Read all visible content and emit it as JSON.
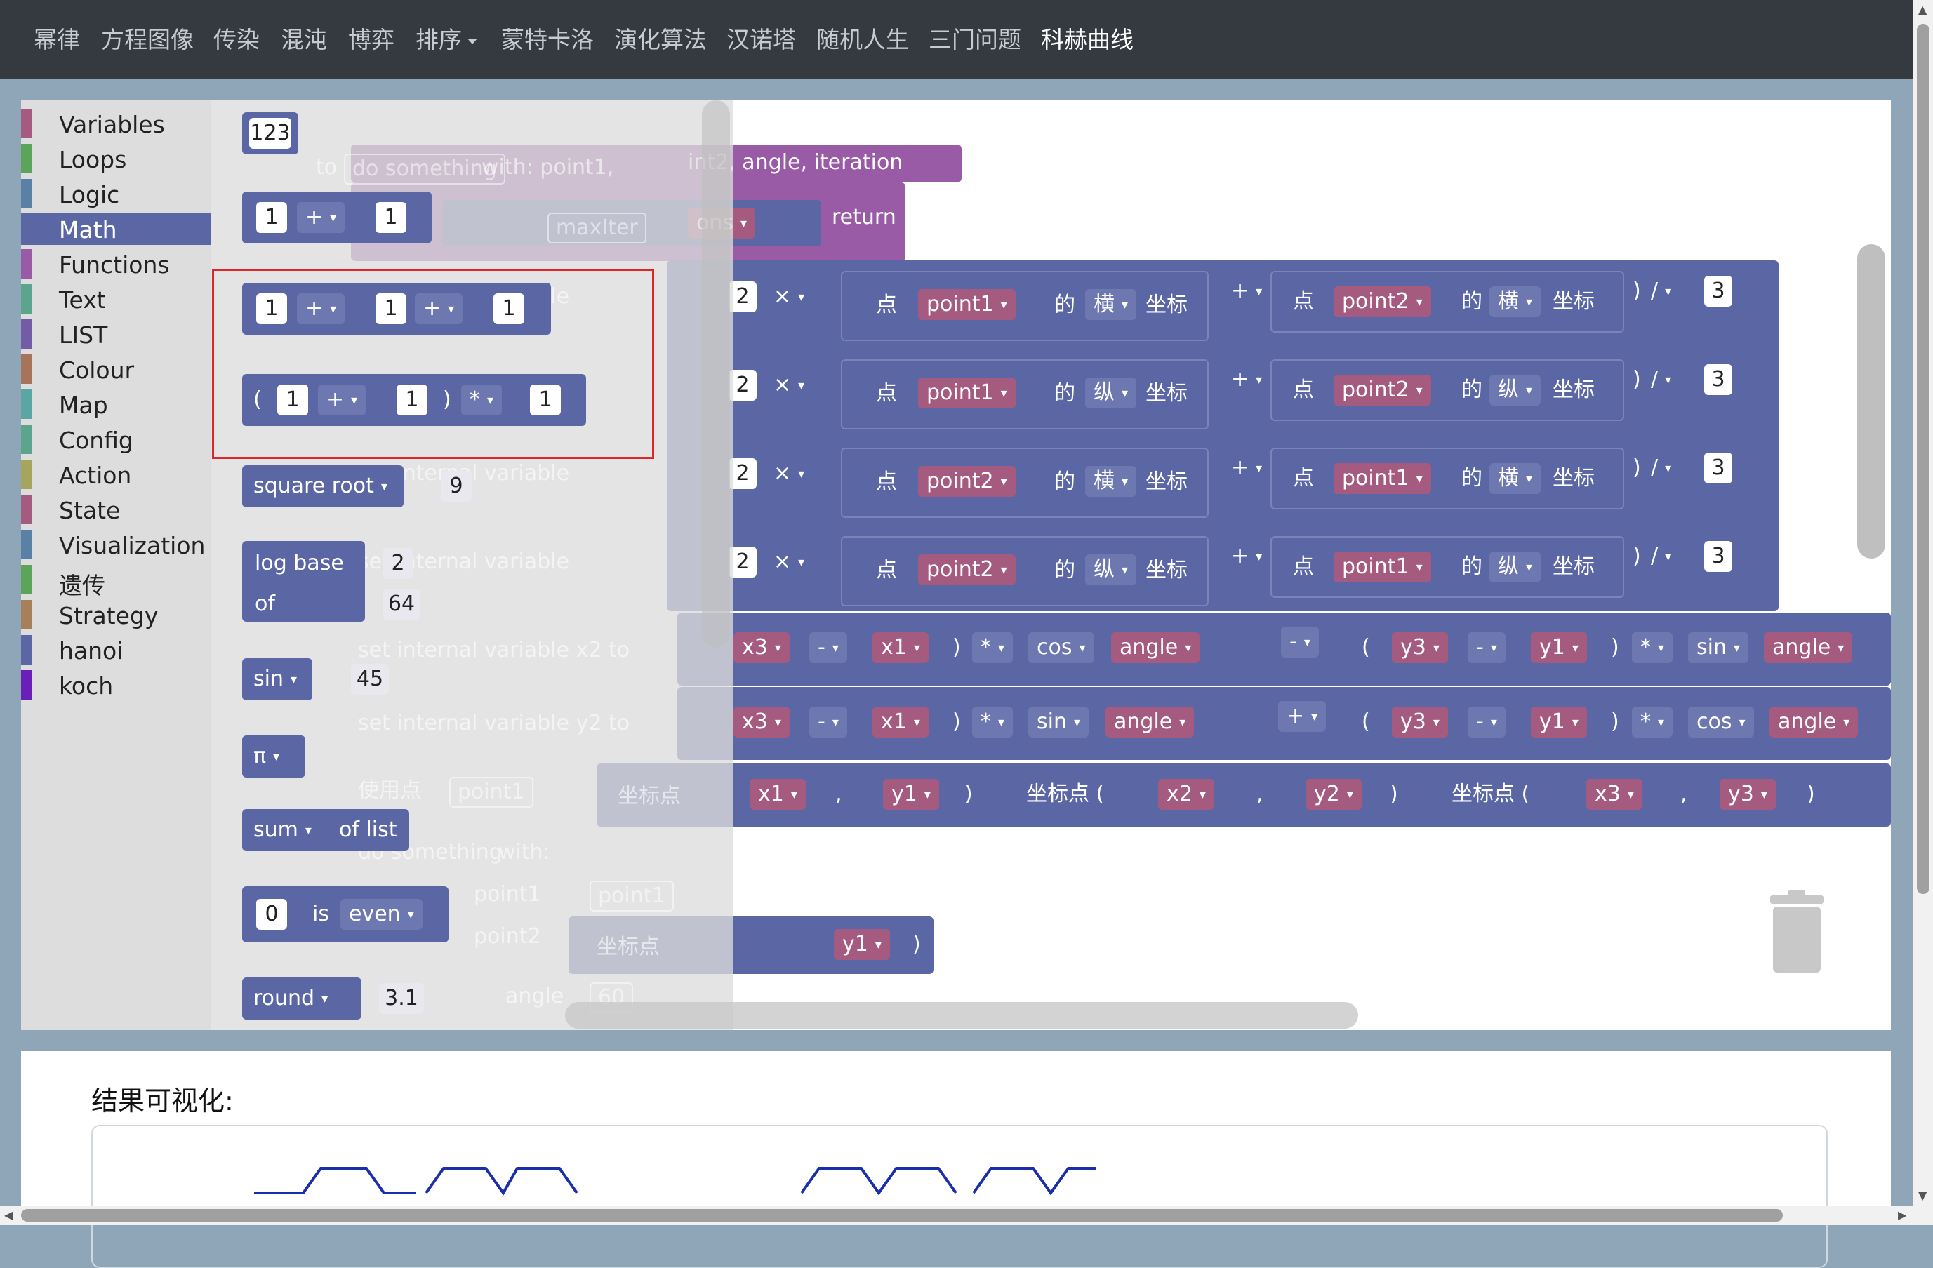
{
  "nav": {
    "items": [
      "幂律",
      "方程图像",
      "传染",
      "混沌",
      "博弈",
      "排序",
      "蒙特卡洛",
      "演化算法",
      "汉诺塔",
      "随机人生",
      "三门问题",
      "科赫曲线"
    ],
    "active_index": 11,
    "dropdown_index": 5
  },
  "toolbox": {
    "categories": [
      {
        "label": "Variables",
        "color": "#a55b80"
      },
      {
        "label": "Loops",
        "color": "#5ba55b"
      },
      {
        "label": "Logic",
        "color": "#5b80a5"
      },
      {
        "label": "Math",
        "color": "#5b67a5"
      },
      {
        "label": "Functions",
        "color": "#995ba5"
      },
      {
        "label": "Text",
        "color": "#5ba58c"
      },
      {
        "label": "LIST",
        "color": "#745ba5"
      },
      {
        "label": "Colour",
        "color": "#a5745b"
      },
      {
        "label": "Map",
        "color": "#5ba5a5"
      },
      {
        "label": "Config",
        "color": "#5ba58c"
      },
      {
        "label": "Action",
        "color": "#a5a55b"
      },
      {
        "label": "State",
        "color": "#a55b80"
      },
      {
        "label": "Visualization",
        "color": "#5b80a5"
      },
      {
        "label": "遗传",
        "color": "#5ba55b"
      },
      {
        "label": "Strategy",
        "color": "#a5805b"
      },
      {
        "label": "hanoi",
        "color": "#5b67a5"
      },
      {
        "label": "koch",
        "color": "#6a1fb8"
      }
    ],
    "selected_index": 3
  },
  "flyout": {
    "number": "123",
    "arith_a": "1",
    "arith_op": "+",
    "arith_b": "1",
    "chain_a": "1",
    "chain_op1": "+",
    "chain_b": "1",
    "chain_op2": "+",
    "chain_c": "1",
    "paren_open": "(",
    "paren_a": "1",
    "paren_op": "+",
    "paren_b": "1",
    "paren_close": ")",
    "paren_op2": "*",
    "paren_c": "1",
    "sqrt_label": "square root",
    "sqrt_val": "9",
    "log_label": "log base",
    "log_base": "2",
    "log_of": "of",
    "log_val": "64",
    "sin_label": "sin",
    "sin_val": "45",
    "pi_label": "π",
    "sum_label": "sum",
    "sum_of": "of list",
    "even_val": "0",
    "even_is": "is",
    "even_label": "even",
    "round_label": "round",
    "round_val": "3.1"
  },
  "canvas": {
    "proc_header": "to  do something  with: point1, point2, angle, iteration",
    "proc_to": "to",
    "proc_name": "do something",
    "proc_params": "with: point1,",
    "proc_params2": "int2, angle, iteration",
    "return_label": "return",
    "if_iteration": "eration",
    "if_op": ">",
    "if_max": "maxIter",
    "if_max2": "ons",
    "set_label": "set internal variable",
    "to": "to",
    "set_vars": [
      "x1",
      "y1",
      "x3",
      "y3",
      "x2",
      "y2"
    ],
    "row_mult": "2",
    "times": "×",
    "dian": "点",
    "de": "的",
    "heng": "横",
    "zong": "纵",
    "zuobiao": "坐标",
    "plus": "+",
    "minus": "-",
    "star": "*",
    "div": "/",
    "three": "3",
    "lp": "(",
    "rp": ")",
    "comma": ",",
    "rows": [
      {
        "p1": "point1",
        "axis1": "横",
        "p2": "point2",
        "axis2": "横"
      },
      {
        "p1": "point1",
        "axis1": "纵",
        "p2": "point2",
        "axis2": "纵"
      },
      {
        "p1": "point2",
        "axis1": "横",
        "p2": "point1",
        "axis2": "横"
      },
      {
        "p1": "point2",
        "axis1": "纵",
        "p2": "point1",
        "axis2": "纵"
      }
    ],
    "x3": "x3",
    "x1": "x1",
    "y3": "y3",
    "y1": "y1",
    "x2": "x2",
    "y2": "y2",
    "cos": "cos",
    "sin": "sin",
    "angle": "angle",
    "use_point": "使用点",
    "point1": "point1",
    "coord_point": "坐标点",
    "do_something": "do something",
    "with": "with:",
    "arg_point1": "point1",
    "arg_point2": "point2",
    "arg_angle": "angle",
    "arg_angle_val": "60"
  },
  "result": {
    "title": "结果可视化:"
  }
}
